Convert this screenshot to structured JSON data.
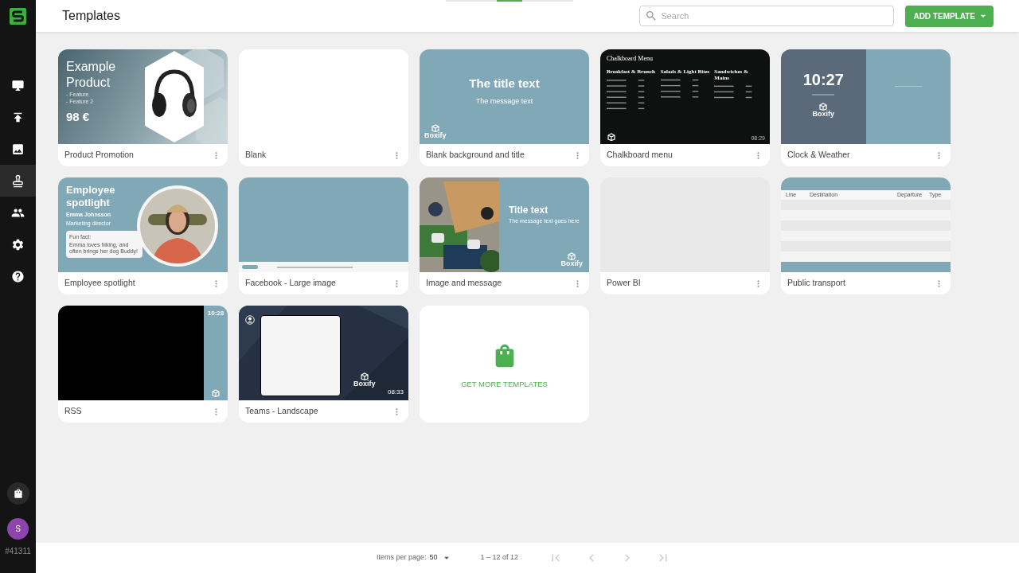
{
  "sidebar": {
    "items": [
      {
        "selected": false
      },
      {
        "selected": false
      },
      {
        "selected": false
      },
      {
        "selected": true
      },
      {
        "selected": false
      },
      {
        "selected": false
      },
      {
        "selected": false
      }
    ],
    "user": {
      "initial": "S",
      "account": "#41311"
    }
  },
  "header": {
    "title": "Templates",
    "search": {
      "placeholder": "Search"
    },
    "add_button": "ADD TEMPLATE"
  },
  "templates": [
    {
      "name": "Product Promotion",
      "preview": {
        "kind": "promo",
        "title": "Example Product",
        "features": [
          "- Feature",
          "- Feature 2"
        ],
        "price": "98 €"
      }
    },
    {
      "name": "Blank",
      "preview": {
        "kind": "blank"
      }
    },
    {
      "name": "Blank background and title",
      "preview": {
        "kind": "title",
        "title": "The title text",
        "message": "The message text",
        "brand": "Boxify"
      }
    },
    {
      "name": "Chalkboard menu",
      "preview": {
        "kind": "chalkboard",
        "title": "Chalkboard Menu",
        "sections": [
          "Breakfast & Brunch",
          "Salads & Light Bites",
          "Sandwiches & Mains"
        ],
        "time": "08:29"
      }
    },
    {
      "name": "Clock & Weather",
      "preview": {
        "kind": "clock",
        "time": "10:27",
        "brand": "Boxify"
      }
    },
    {
      "name": "Employee spotlight",
      "preview": {
        "kind": "spotlight",
        "title": "Employee spotlight",
        "person": "Emma Johnsson",
        "role": "Marketing director",
        "fact_label": "Fun fact:",
        "fact": "Emma loves hiking, and often brings her dog Buddy!"
      }
    },
    {
      "name": "Facebook - Large image",
      "preview": {
        "kind": "facebook"
      }
    },
    {
      "name": "Image and message",
      "preview": {
        "kind": "image_message",
        "title": "Title text",
        "message": "The message text goes here",
        "brand": "Boxify"
      }
    },
    {
      "name": "Power BI",
      "preview": {
        "kind": "powerbi"
      }
    },
    {
      "name": "Public transport",
      "preview": {
        "kind": "transport",
        "columns": [
          "Line",
          "Destination",
          "Departure",
          "Type"
        ]
      }
    },
    {
      "name": "RSS",
      "preview": {
        "kind": "rss",
        "time": "10:28"
      }
    },
    {
      "name": "Teams - Landscape",
      "preview": {
        "kind": "teams",
        "time": "08:33",
        "brand": "Boxify"
      }
    }
  ],
  "more_card": {
    "label": "GET MORE TEMPLATES"
  },
  "pagination": {
    "items_per_page_label": "Items per page:",
    "items_per_page": "50",
    "range": "1 – 12 of 12"
  }
}
